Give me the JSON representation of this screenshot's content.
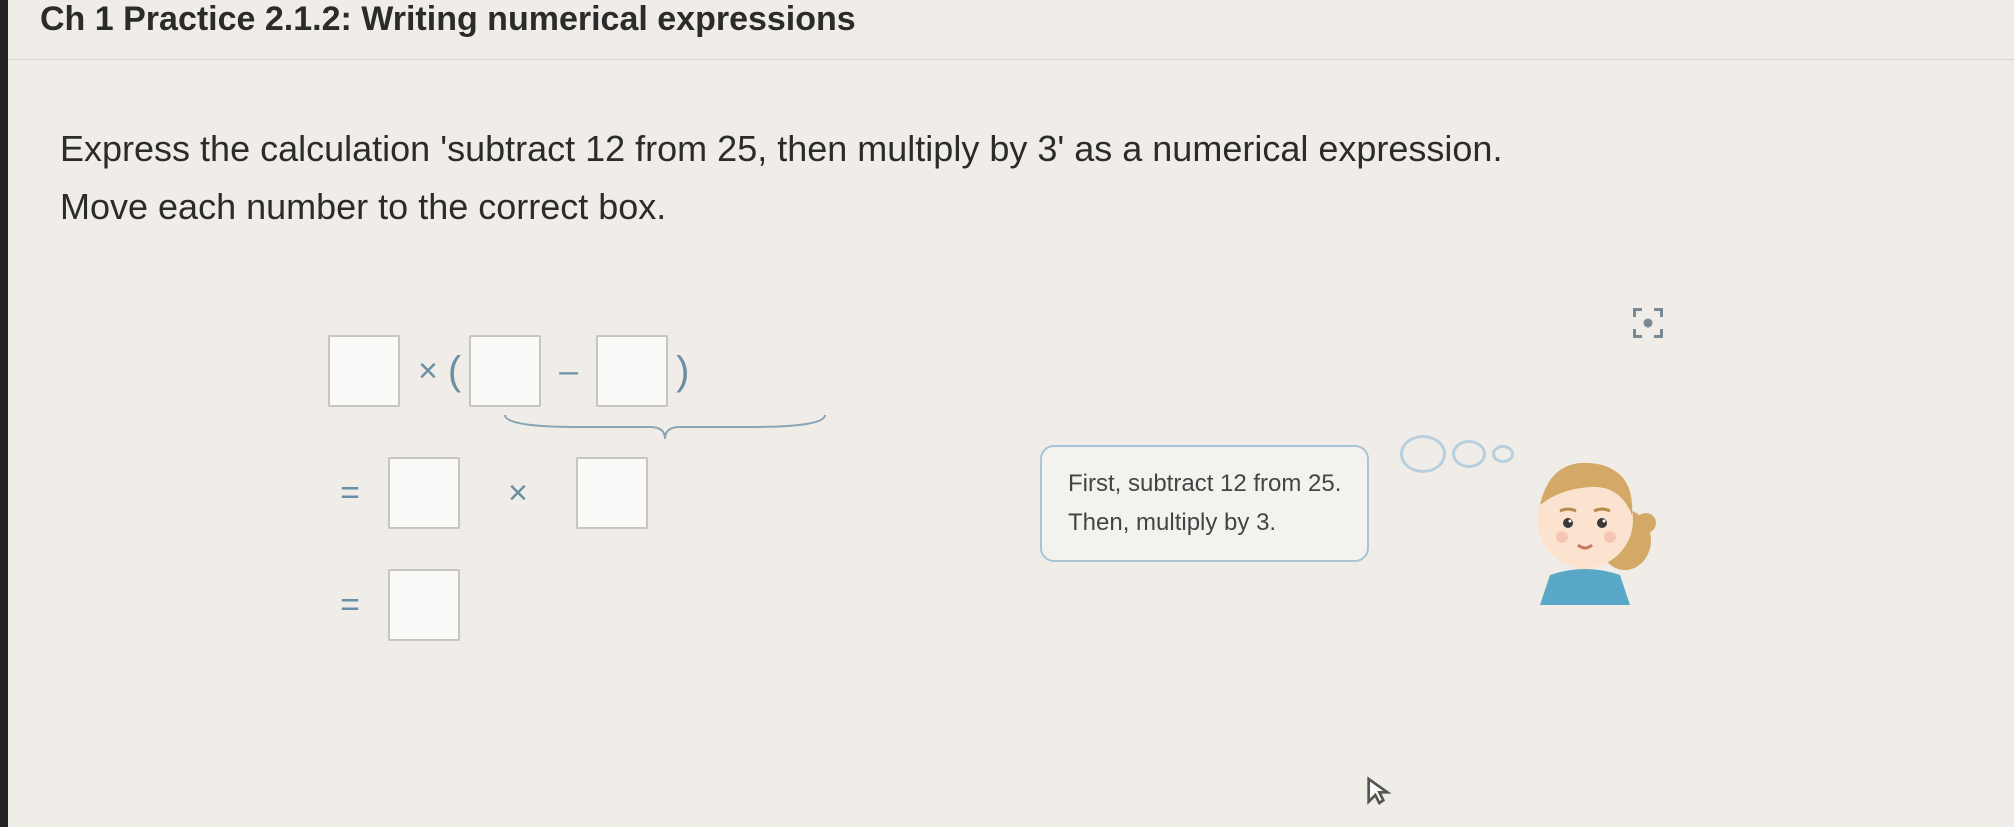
{
  "header": {
    "breadcrumb": "Ch 1 Practice 2.1.2: Writing numerical expressions"
  },
  "question": {
    "line1": "Express the calculation 'subtract 12 from 25, then multiply by 3' as a numerical expression.",
    "line2": "Move each number to the correct box."
  },
  "expression": {
    "row1": {
      "times": "×",
      "open_paren": "(",
      "minus": "–",
      "close_paren": ")"
    },
    "row2": {
      "equals": "=",
      "times": "×"
    },
    "row3": {
      "equals": "="
    }
  },
  "hint": {
    "line1": "First, subtract 12 from 25.",
    "line2": "Then, multiply by 3."
  }
}
